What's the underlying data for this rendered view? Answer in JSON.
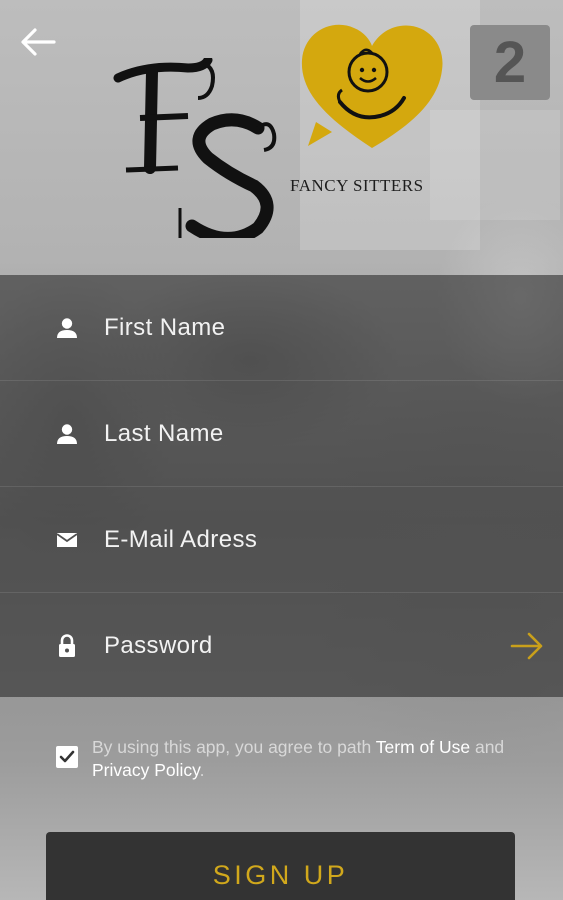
{
  "brand": {
    "name": "FANCY SITTERS",
    "monogram": "FS",
    "accent_color": "#d4a80e"
  },
  "nav": {
    "back_icon": "arrow-left-icon"
  },
  "form": {
    "first_name": {
      "placeholder": "First Name",
      "value": "",
      "icon": "user-icon"
    },
    "last_name": {
      "placeholder": "Last Name",
      "value": "",
      "icon": "user-icon"
    },
    "email": {
      "placeholder": "E-Mail Adress",
      "value": "",
      "icon": "mail-icon"
    },
    "password": {
      "placeholder": "Password",
      "value": "",
      "icon": "lock-icon"
    },
    "submit_icon": "arrow-right-icon"
  },
  "terms": {
    "checked": true,
    "text_prefix": "By using this app, you agree to path ",
    "link_term": "Term of Use",
    "text_and": " and ",
    "link_privacy": "Privacy Policy",
    "text_suffix": "."
  },
  "actions": {
    "signup_label": "SIGN UP"
  }
}
